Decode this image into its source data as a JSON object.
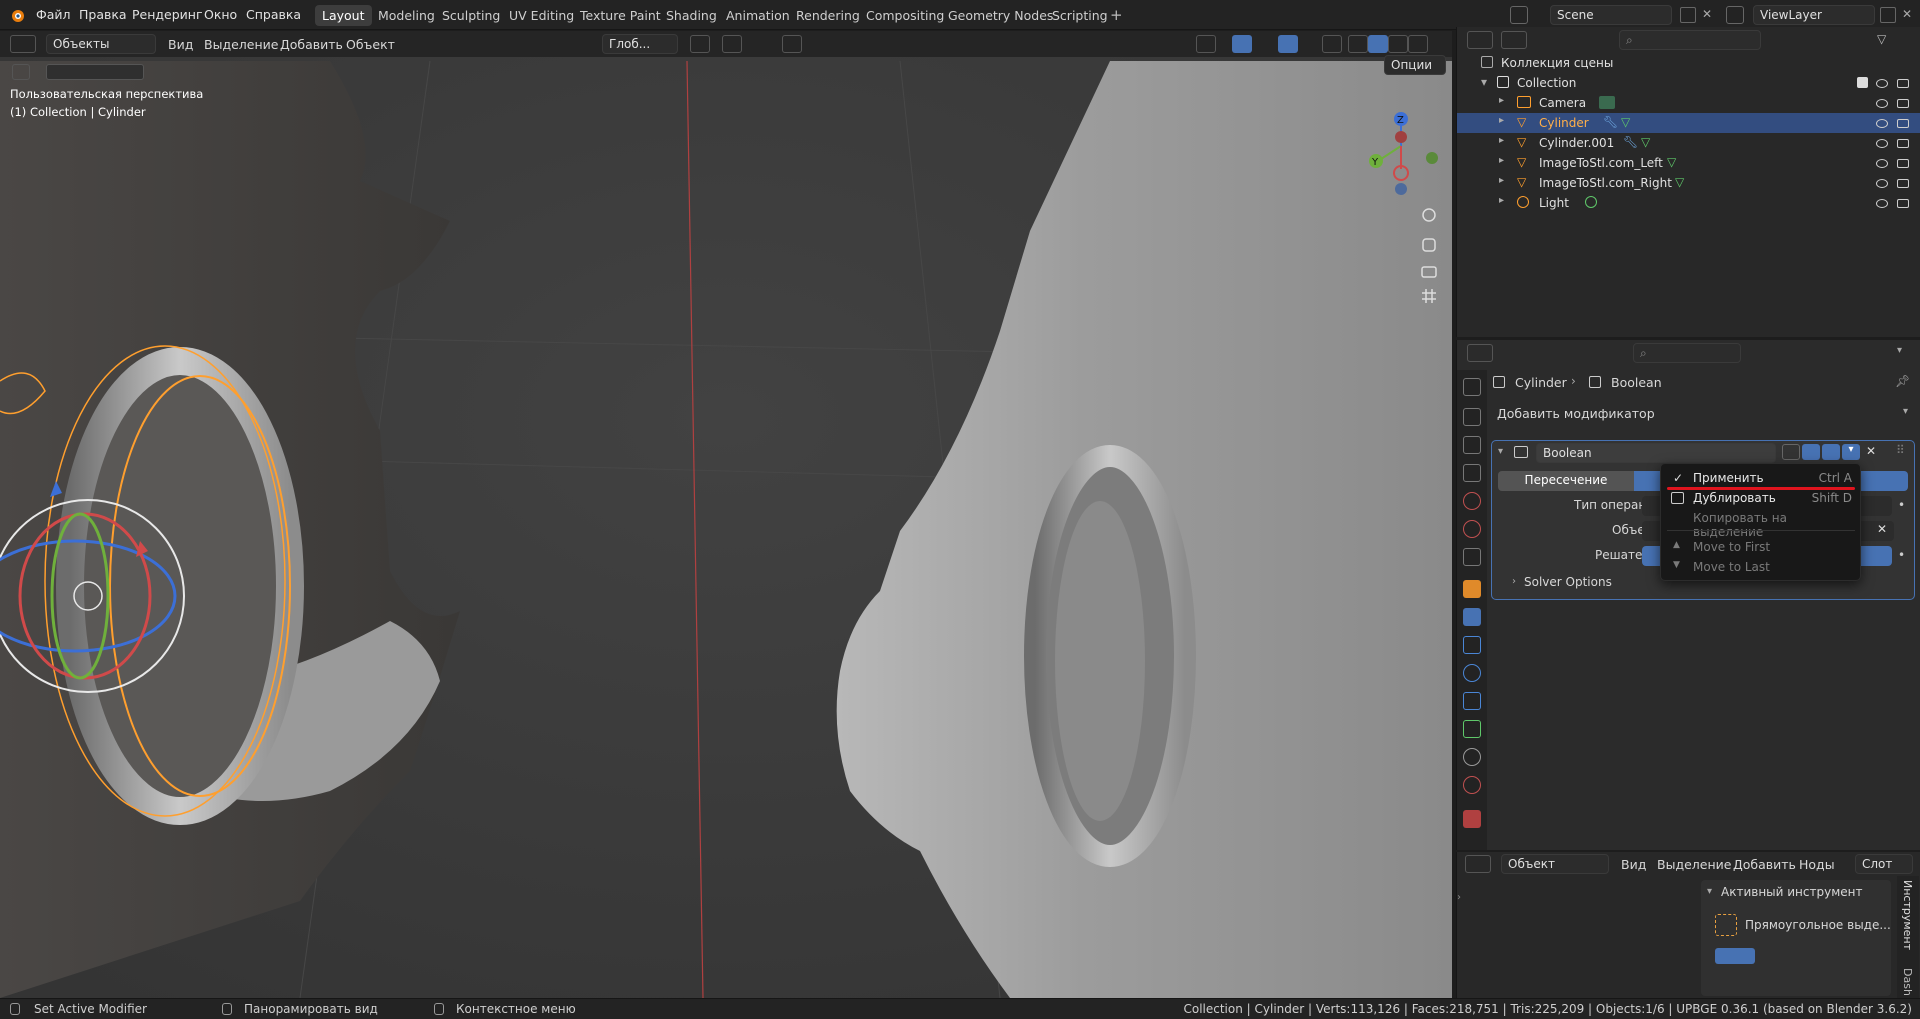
{
  "topbar": {
    "menus": [
      "Файл",
      "Правка",
      "Рендеринг",
      "Окно",
      "Справка"
    ],
    "workspaces": [
      "Layout",
      "Modeling",
      "Sculpting",
      "UV Editing",
      "Texture Paint",
      "Shading",
      "Animation",
      "Rendering",
      "Compositing",
      "Geometry Nodes",
      "Scripting"
    ],
    "active_workspace": "Layout",
    "scene": "Scene",
    "view_layer": "ViewLayer"
  },
  "viewport_header": {
    "mode": "Объекты",
    "menus": [
      "Вид",
      "Выделение",
      "Добавить",
      "Объект"
    ],
    "transform": "Глоб...",
    "options": "Опции"
  },
  "viewport": {
    "view_name": "Пользовательская перспектива",
    "context": "(1) Collection | Cylinder",
    "gizmo": {
      "z": "Z",
      "y": "Y"
    }
  },
  "outliner": {
    "root": "Коллекция сцены",
    "collection": "Collection",
    "items": [
      {
        "name": "Camera",
        "selected": false
      },
      {
        "name": "Cylinder",
        "selected": true
      },
      {
        "name": "Cylinder.001",
        "selected": false
      },
      {
        "name": "ImageToStl.com_Left",
        "selected": false
      },
      {
        "name": "ImageToStl.com_Right",
        "selected": false
      },
      {
        "name": "Light",
        "selected": false
      }
    ]
  },
  "properties": {
    "breadcrumb_object": "Cylinder",
    "breadcrumb_modifier": "Boolean",
    "add_modifier": "Добавить модификатор",
    "modifier_name": "Boolean",
    "operation": "Пересечение",
    "operand_type_label": "Тип операнда",
    "object_label": "Объект",
    "solver_label": "Решатель",
    "solver_options": "Solver Options"
  },
  "dropdown": {
    "items": [
      {
        "label": "Применить",
        "shortcut": "Ctrl A",
        "enabled": true
      },
      {
        "label": "Дублировать",
        "shortcut": "Shift D",
        "enabled": true
      },
      {
        "label": "Копировать на выделение",
        "shortcut": "",
        "enabled": false
      },
      {
        "label": "Move to First",
        "shortcut": "",
        "enabled": false
      },
      {
        "label": "Move to Last",
        "shortcut": "",
        "enabled": false
      }
    ],
    "annotation_color": "#e0141e"
  },
  "tool_panel": {
    "mode": "Объект",
    "menus": [
      "Вид",
      "Выделение",
      "Добавить",
      "Ноды"
    ],
    "slot": "Слот",
    "active_tool_header": "Активный инструмент",
    "tool_name": "Прямоугольное выде...",
    "side_tab": "Инструмент",
    "side_tab2": "Dash"
  },
  "statusbar": {
    "left1": "Set Active Modifier",
    "left2": "Панорамировать вид",
    "left3": "Контекстное меню",
    "stats": "Collection | Cylinder | Verts:113,126 | Faces:218,751 | Tris:225,209 | Objects:1/6 | UPBGE 0.36.1 (based on Blender 3.6.2)"
  },
  "colors": {
    "accent": "#4772b3",
    "selected_row": "#334d80",
    "orange": "#ff9f2e"
  }
}
